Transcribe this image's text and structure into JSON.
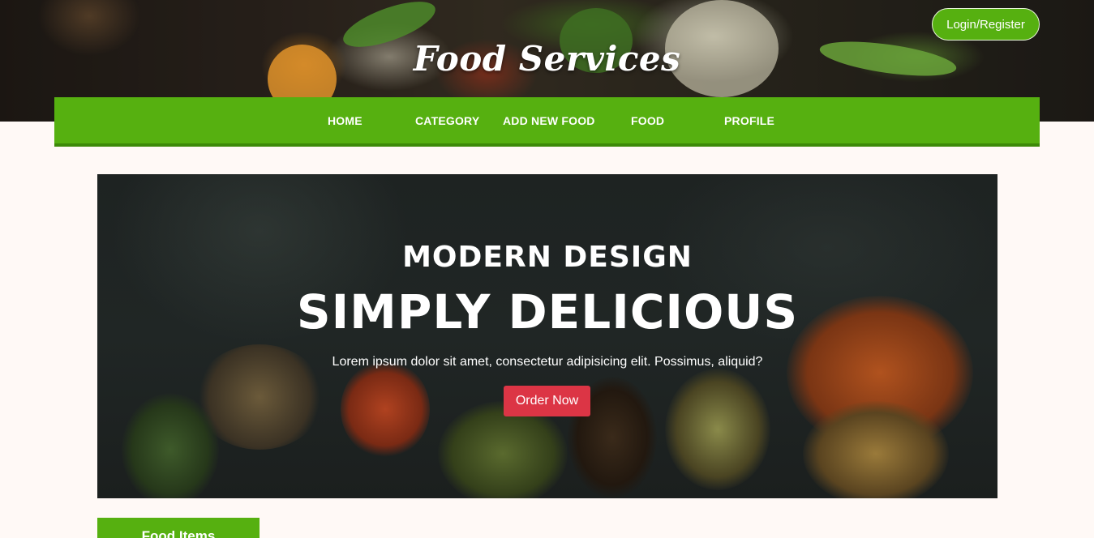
{
  "header": {
    "site_title": "Food Services",
    "login_label": "Login/Register"
  },
  "nav": {
    "items": [
      {
        "label": "HOME"
      },
      {
        "label": "CATEGORY"
      },
      {
        "label": "ADD NEW FOOD"
      },
      {
        "label": "FOOD"
      },
      {
        "label": "PROFILE"
      }
    ]
  },
  "hero": {
    "subtitle": "MODERN DESIGN",
    "title": "SIMPLY DELICIOUS",
    "text": "Lorem ipsum dolor sit amet, consectetur adipisicing elit. Possimus, aliquid?",
    "button_label": "Order Now"
  },
  "section": {
    "food_items_label": "Food Items"
  },
  "colors": {
    "brand_green": "#56b010",
    "order_red": "#dc3545",
    "page_background": "#fff9f6"
  }
}
